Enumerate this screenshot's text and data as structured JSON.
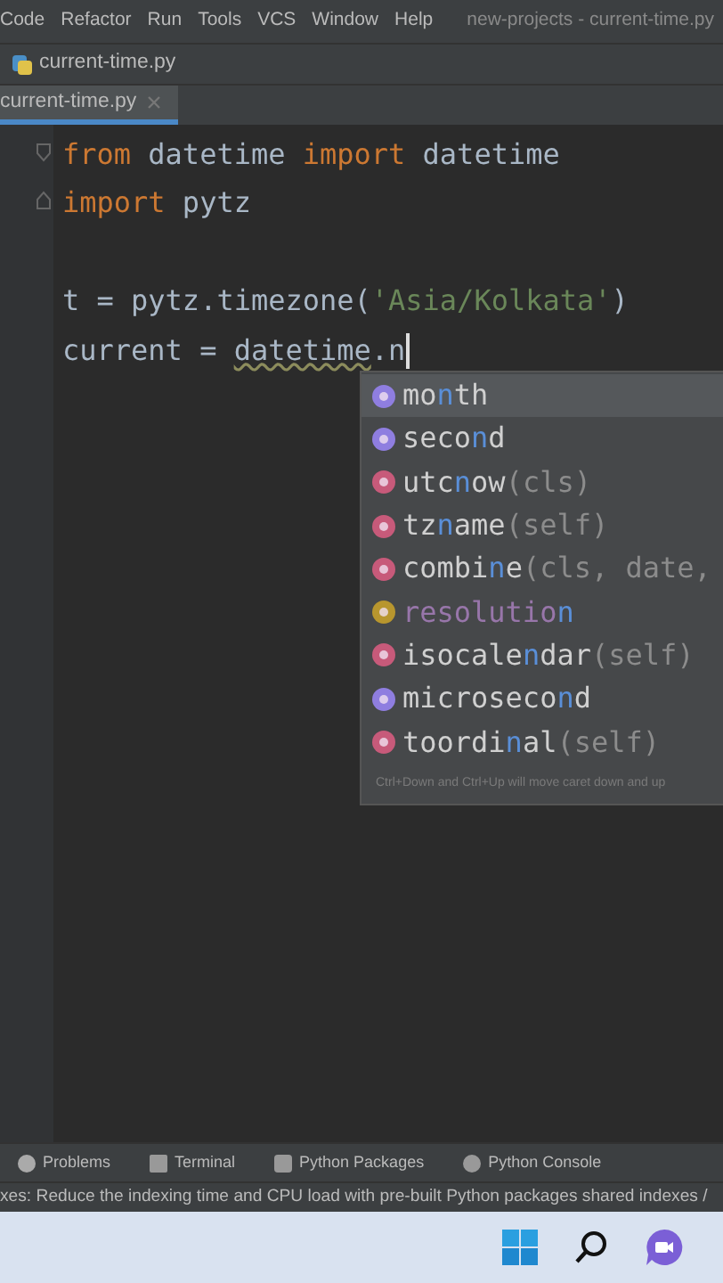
{
  "menu_bar": {
    "items": [
      "Code",
      "Refactor",
      "Run",
      "Tools",
      "VCS",
      "Window",
      "Help"
    ],
    "title": "new-projects - current-time.py"
  },
  "breadcrumb": {
    "file": "current-time.py"
  },
  "tabs": [
    {
      "label": "current-time.py",
      "selected": true
    }
  ],
  "editor": {
    "lines": [
      {
        "kind": "code",
        "tokens": [
          {
            "kind": "keyword",
            "text": "from"
          },
          {
            "kind": "plain",
            "text": " datetime "
          },
          {
            "kind": "keyword",
            "text": "import"
          },
          {
            "kind": "plain",
            "text": " datetime"
          }
        ]
      },
      {
        "kind": "code",
        "tokens": [
          {
            "kind": "keyword",
            "text": "import"
          },
          {
            "kind": "plain",
            "text": " pytz"
          }
        ]
      },
      {
        "kind": "blank"
      },
      {
        "kind": "code",
        "tokens": [
          {
            "kind": "plain",
            "text": "t = pytz.timezone("
          },
          {
            "kind": "string",
            "text": "'Asia/Kolkata'"
          },
          {
            "kind": "plain",
            "text": ")"
          }
        ]
      },
      {
        "kind": "code",
        "tokens": [
          {
            "kind": "plain",
            "text": "current = "
          },
          {
            "kind": "underlined",
            "text": "datetime"
          },
          {
            "kind": "plain",
            "text": ".n"
          }
        ]
      }
    ]
  },
  "completion": {
    "items": [
      {
        "kind": "property",
        "pre": "mo",
        "match": "n",
        "post": "th",
        "selected": true
      },
      {
        "kind": "property",
        "pre": "seco",
        "match": "n",
        "post": "d",
        "selected": false
      },
      {
        "kind": "method",
        "pre": "utc",
        "match": "n",
        "post": "ow",
        "args": "(cls)",
        "selected": false
      },
      {
        "kind": "method",
        "pre": "tz",
        "match": "n",
        "post": "ame",
        "args": "(self)",
        "selected": false
      },
      {
        "kind": "method",
        "pre": "combi",
        "match": "n",
        "post": "e",
        "args": "(cls, date,",
        "selected": false
      },
      {
        "kind": "field",
        "pre": "resolutio",
        "match": "n",
        "selected": false
      },
      {
        "kind": "method",
        "pre": "isocale",
        "match": "n",
        "post": "dar",
        "args": "(self)",
        "selected": false
      },
      {
        "kind": "property",
        "pre": "microseco",
        "match": "n",
        "post": "d",
        "selected": false
      },
      {
        "kind": "method",
        "pre": "toordi",
        "match": "n",
        "post": "al",
        "args": "(self)",
        "selected": false
      }
    ],
    "hint": "Ctrl+Down and Ctrl+Up will move caret down and up"
  },
  "tool_windows": [
    "Problems",
    "Terminal",
    "Python Packages",
    "Python Console"
  ],
  "status": "xes: Reduce the indexing time and CPU load with pre-built Python packages shared indexes /"
}
